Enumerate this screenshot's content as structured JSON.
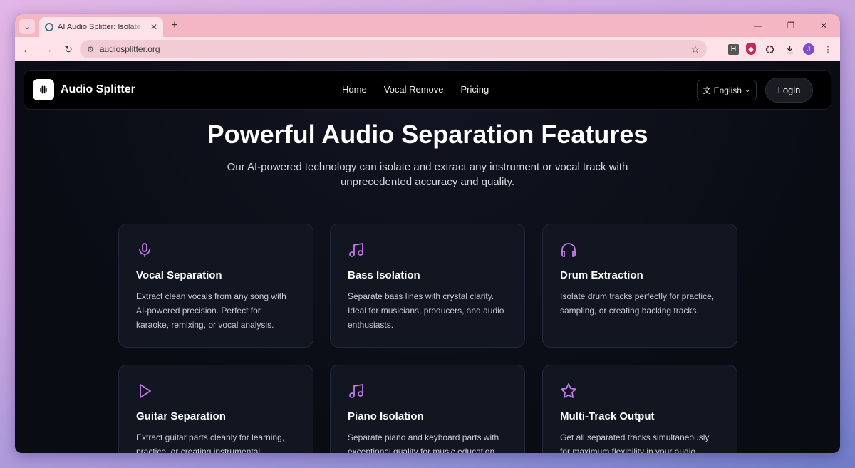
{
  "browser": {
    "tab_title": "AI Audio Splitter: Isolate Vocals",
    "url": "audiosplitter.org",
    "avatar_letter": "J",
    "ext_h_label": "H"
  },
  "site": {
    "brand": "Audio Splitter",
    "nav": [
      "Home",
      "Vocal Remove",
      "Pricing"
    ],
    "language": "English",
    "login": "Login"
  },
  "hero": {
    "title": "Powerful Audio Separation Features",
    "subtitle": "Our AI-powered technology can isolate and extract any instrument or vocal track with unprecedented accuracy and quality."
  },
  "accent_color": "#c27ae8",
  "features": [
    {
      "icon": "microphone-icon",
      "title": "Vocal Separation",
      "desc": "Extract clean vocals from any song with AI-powered precision. Perfect for karaoke, remixing, or vocal analysis."
    },
    {
      "icon": "music-note-icon",
      "title": "Bass Isolation",
      "desc": "Separate bass lines with crystal clarity. Ideal for musicians, producers, and audio enthusiasts."
    },
    {
      "icon": "headphones-icon",
      "title": "Drum Extraction",
      "desc": "Isolate drum tracks perfectly for practice, sampling, or creating backing tracks."
    },
    {
      "icon": "play-icon",
      "title": "Guitar Separation",
      "desc": "Extract guitar parts cleanly for learning, practice, or creating instrumental"
    },
    {
      "icon": "music-note-icon",
      "title": "Piano Isolation",
      "desc": "Separate piano and keyboard parts with exceptional quality for music education"
    },
    {
      "icon": "star-icon",
      "title": "Multi-Track Output",
      "desc": "Get all separated tracks simultaneously for maximum flexibility in your audio"
    }
  ]
}
